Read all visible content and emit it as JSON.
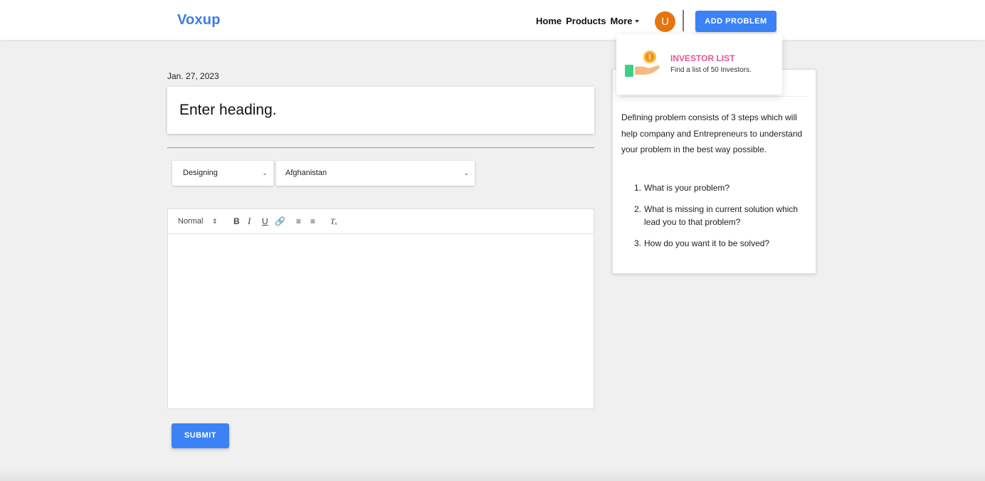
{
  "navbar": {
    "brand": "Voxup",
    "links": [
      {
        "label": "Home"
      },
      {
        "label": "Products"
      },
      {
        "label": "More"
      }
    ],
    "avatar_initial": "U",
    "add_problem_label": "ADD PROBLEM"
  },
  "dropdown": {
    "icon": "investor-hand-coin-icon",
    "title": "INVESTOR LIST",
    "subtitle": "Find a list of 50 Investors."
  },
  "form": {
    "date": "Jan. 27, 2023",
    "heading_placeholder": "Enter heading.",
    "heading_value": "",
    "category_select": {
      "selected": "Designing"
    },
    "country_select": {
      "selected": "Afghanistan"
    },
    "editor": {
      "format_select": "Normal",
      "tools": [
        "bold",
        "italic",
        "underline",
        "link",
        "ordered-list",
        "bullet-list",
        "clear-format"
      ],
      "content": ""
    },
    "submit_label": "SUBMIT"
  },
  "info_card": {
    "intro": "Defining problem consists of 3 steps which will help company and Entrepreneurs to understand your problem in the best way possible.",
    "steps": [
      {
        "num": "1.",
        "text": "What is your problem?"
      },
      {
        "num": "2.",
        "text": "What is missing in current solution which lead you to that problem?"
      },
      {
        "num": "3.",
        "text": "How do you want it to be solved?"
      }
    ]
  },
  "colors": {
    "brand": "#3b7de9",
    "primary_button": "#3b82f6",
    "avatar": "#e8740c",
    "dropdown_title": "#e0569a",
    "page_background": "#f0f0f0"
  }
}
